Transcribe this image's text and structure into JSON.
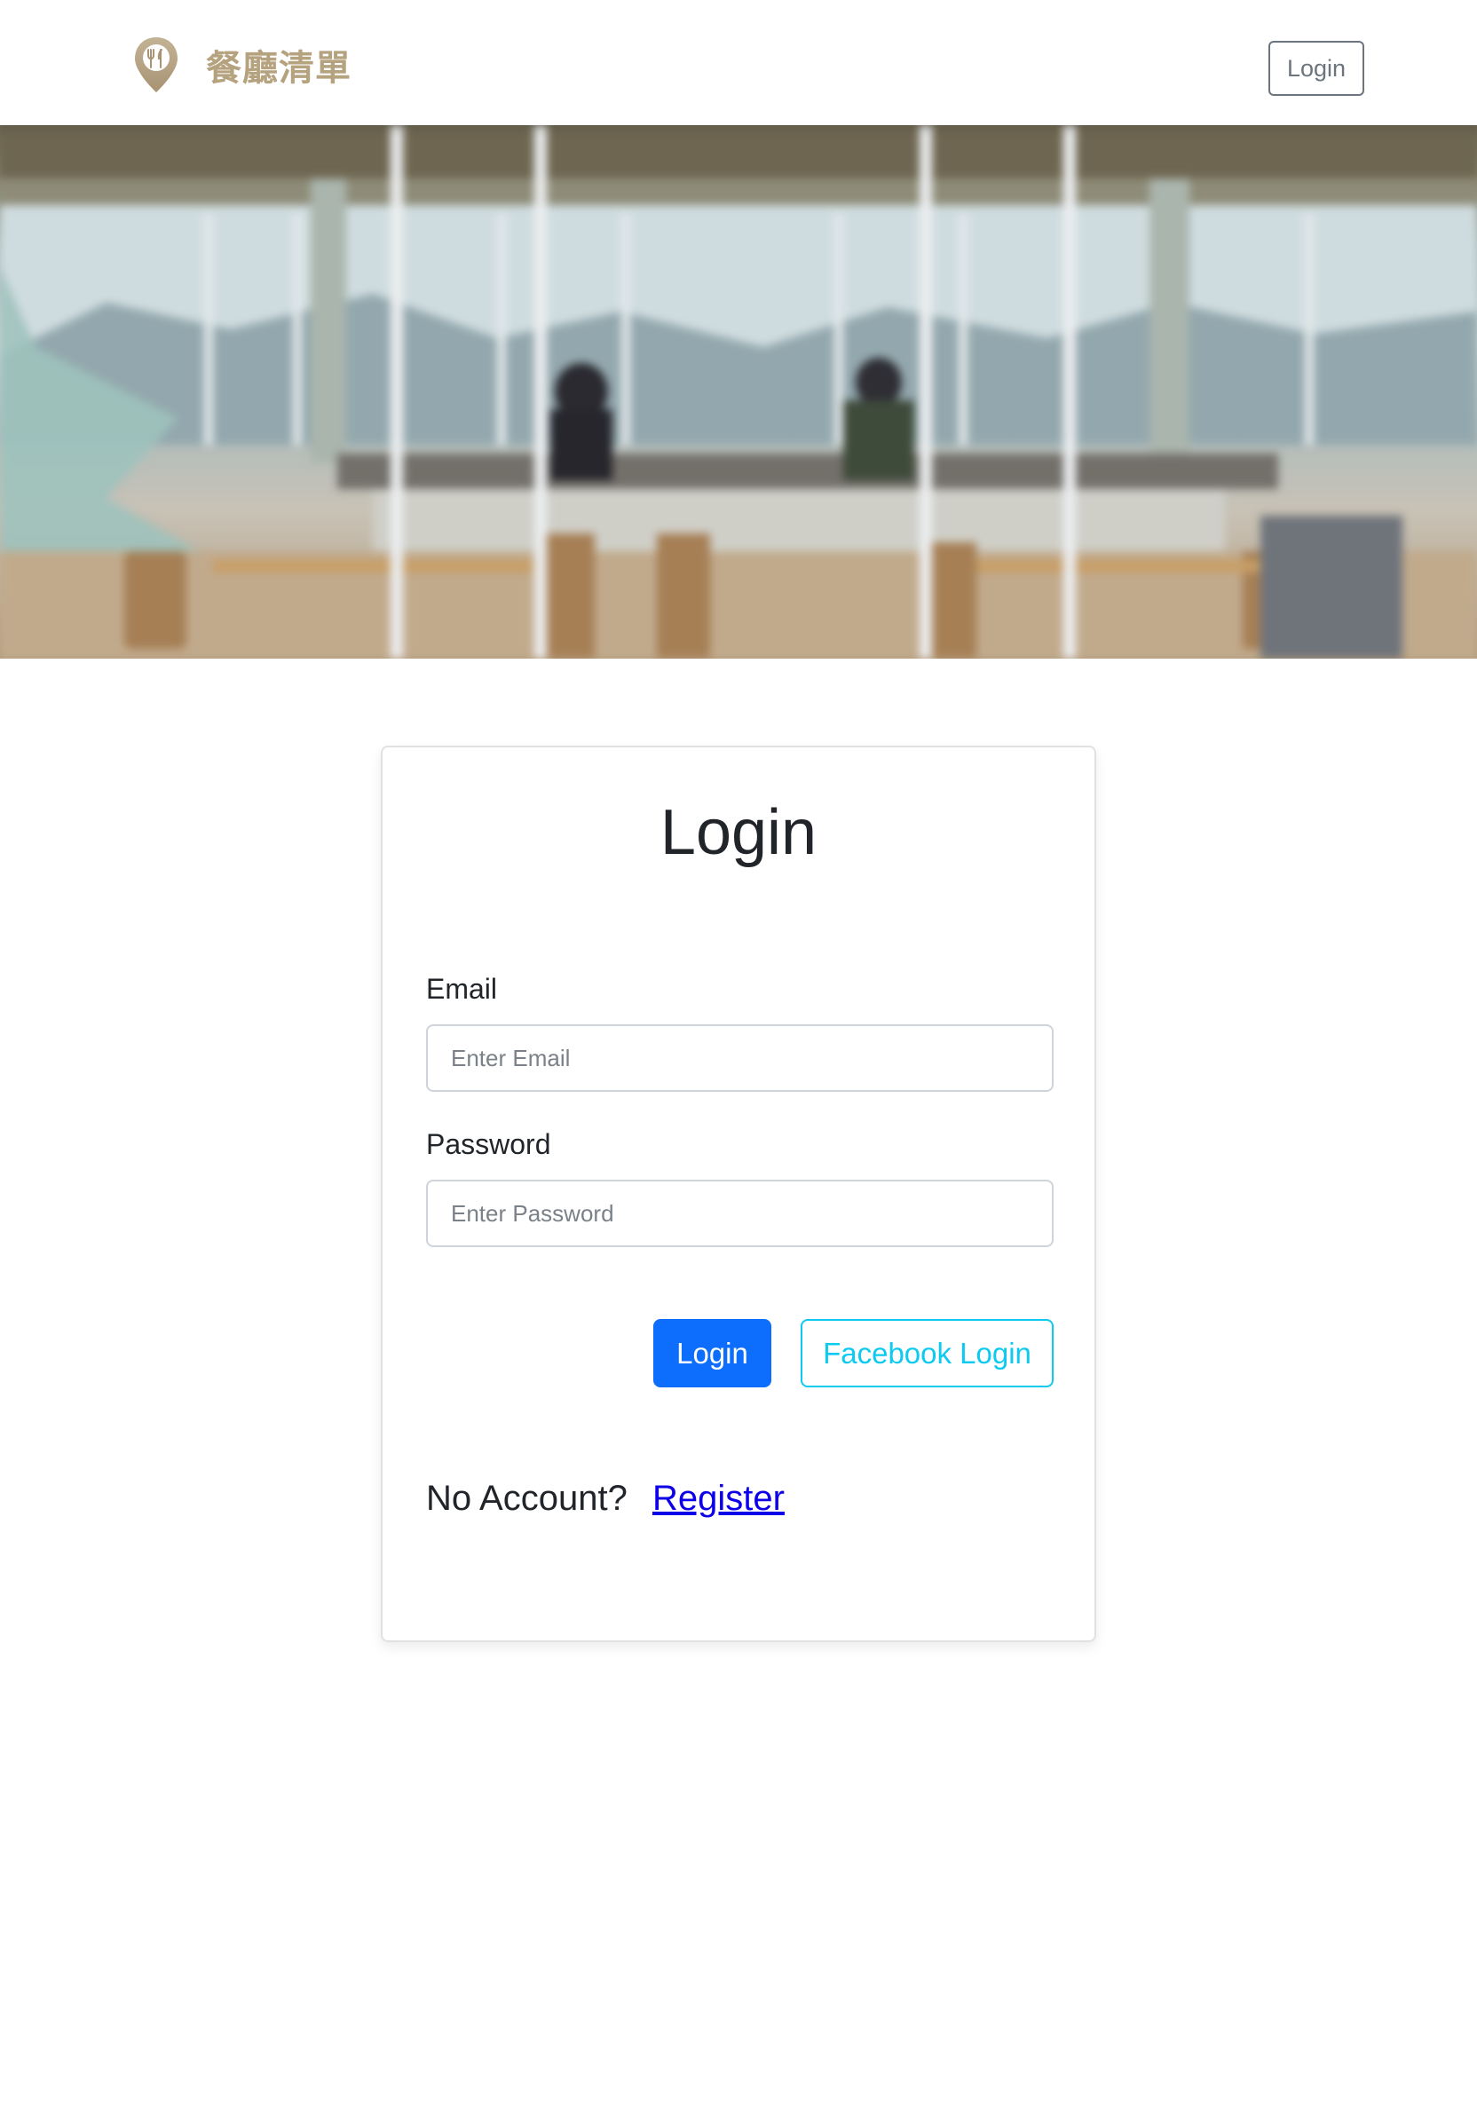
{
  "navbar": {
    "brand_name": "餐廳清單",
    "logo_icon": "location-pin-cutlery-icon",
    "login_button": "Login"
  },
  "hero": {
    "image": "restaurant-interior-photo"
  },
  "login_card": {
    "title": "Login",
    "email": {
      "label": "Email",
      "placeholder": "Enter Email",
      "value": ""
    },
    "password": {
      "label": "Password",
      "placeholder": "Enter Password",
      "value": ""
    },
    "submit_button": "Login",
    "facebook_button": "Facebook Login",
    "no_account_text": "No Account?",
    "register_link": "Register"
  },
  "colors": {
    "brand": "#b5a27f",
    "primary": "#0d6efd",
    "info": "#0dcaf0",
    "link": "#0d00e8",
    "secondary": "#6c757d"
  }
}
